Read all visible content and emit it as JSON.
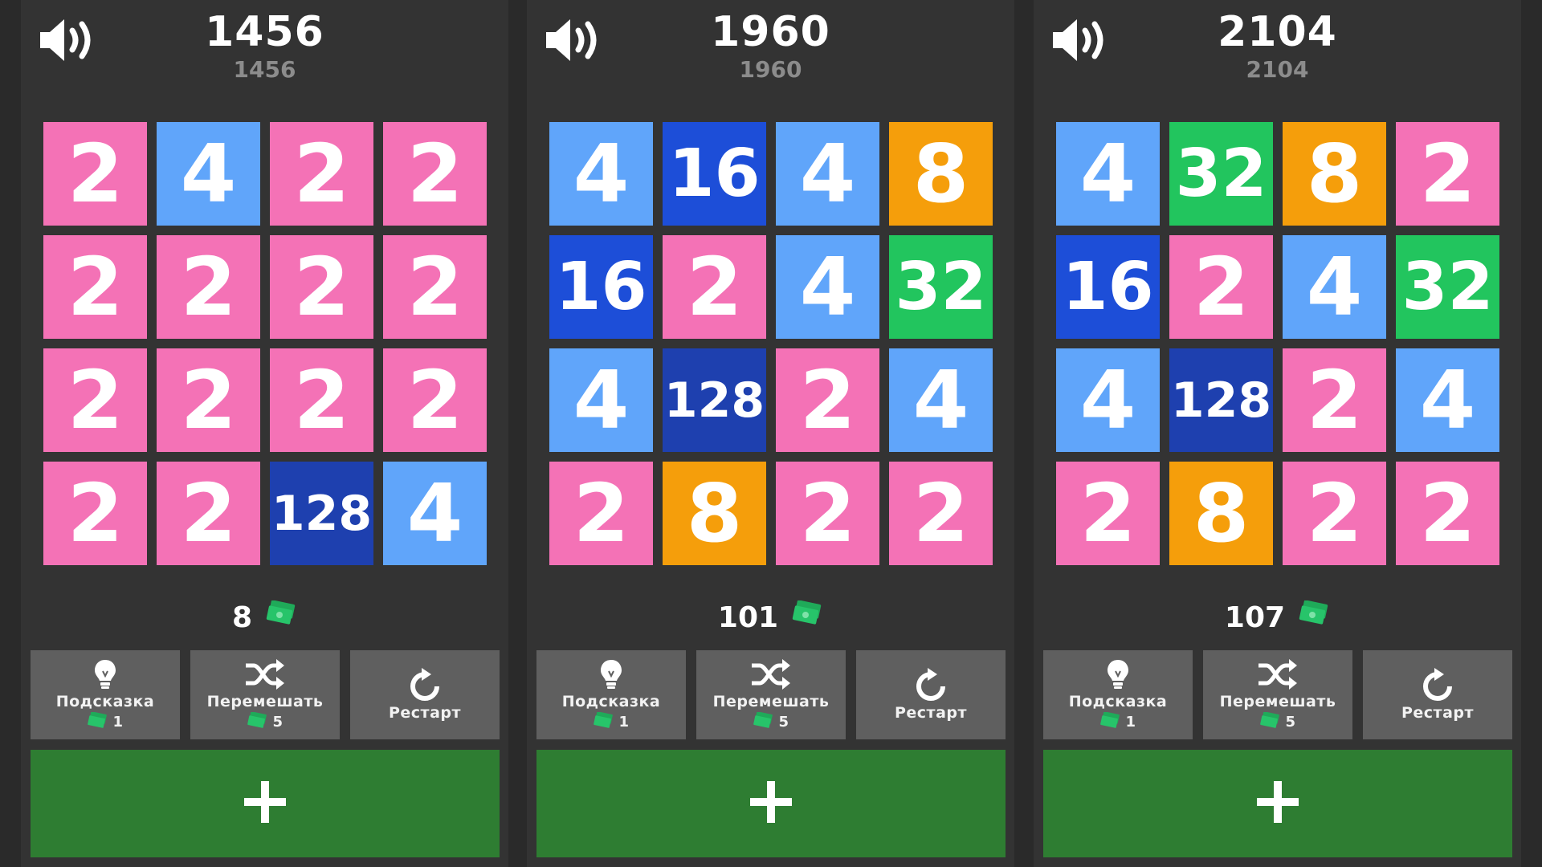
{
  "colors": {
    "2": "#f472b6",
    "4": "#60a5fa",
    "8": "#f59e0b",
    "16": "#1d4ed8",
    "32": "#22c55e",
    "128": "#1e40af"
  },
  "icons": {
    "sound": "speaker-volume-icon",
    "cash": "cash-banknote-icon",
    "hint": "lightbulb-icon",
    "shuffle": "shuffle-icon",
    "restart": "restart-icon",
    "add": "plus-icon"
  },
  "buttons": {
    "hint_label": "Подсказка",
    "hint_cost": "1",
    "shuffle_label": "Перемешать",
    "shuffle_cost": "5",
    "restart_label": "Рестарт",
    "add_label": "+"
  },
  "panels": [
    {
      "score": "1456",
      "best": "1456",
      "coins": "8",
      "grid": [
        [
          2,
          4,
          2,
          2
        ],
        [
          2,
          2,
          2,
          2
        ],
        [
          2,
          2,
          2,
          2
        ],
        [
          2,
          2,
          128,
          4
        ]
      ]
    },
    {
      "score": "1960",
      "best": "1960",
      "coins": "101",
      "grid": [
        [
          4,
          16,
          4,
          8
        ],
        [
          16,
          2,
          4,
          32
        ],
        [
          4,
          128,
          2,
          4
        ],
        [
          2,
          8,
          2,
          2
        ]
      ]
    },
    {
      "score": "2104",
      "best": "2104",
      "coins": "107",
      "grid": [
        [
          4,
          32,
          8,
          2
        ],
        [
          16,
          2,
          4,
          32
        ],
        [
          4,
          128,
          2,
          4
        ],
        [
          2,
          8,
          2,
          2
        ]
      ]
    }
  ]
}
